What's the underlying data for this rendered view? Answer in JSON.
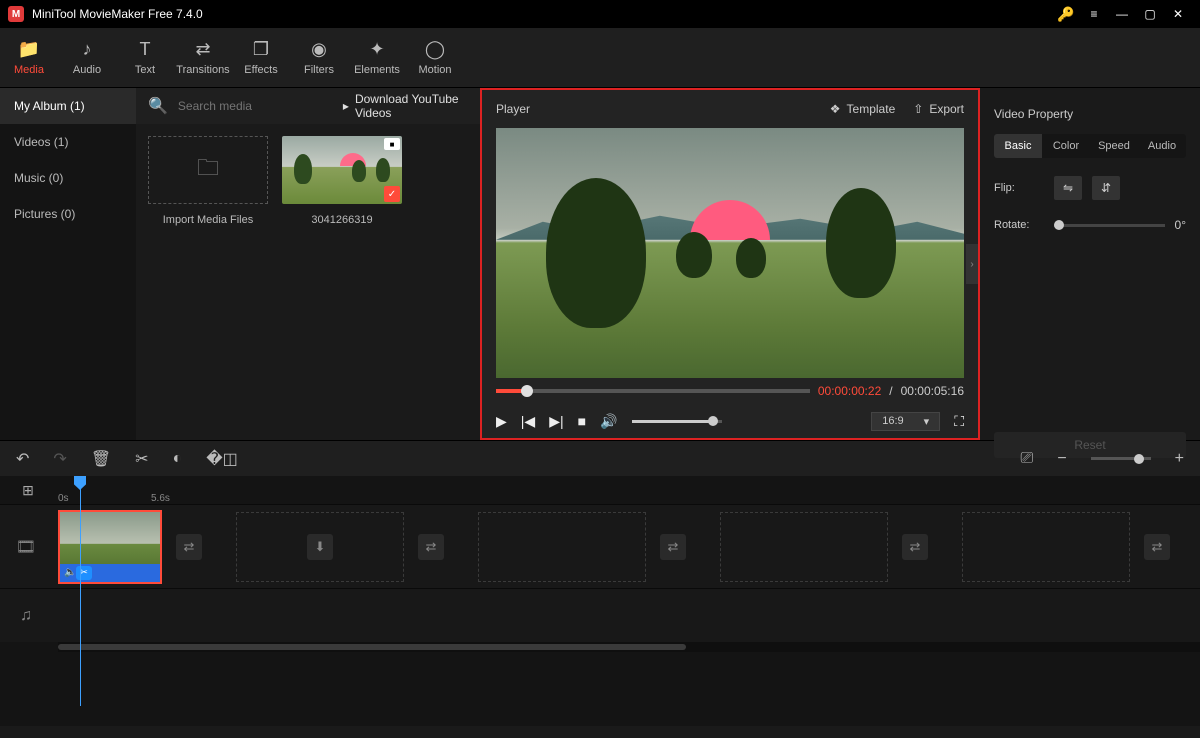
{
  "app": {
    "title": "MiniTool MovieMaker Free 7.4.0"
  },
  "toolTabs": [
    {
      "label": "Media",
      "icon": "📁"
    },
    {
      "label": "Audio",
      "icon": "♪"
    },
    {
      "label": "Text",
      "icon": "T"
    },
    {
      "label": "Transitions",
      "icon": "⇄"
    },
    {
      "label": "Effects",
      "icon": "❐"
    },
    {
      "label": "Filters",
      "icon": "◉"
    },
    {
      "label": "Elements",
      "icon": "✦"
    },
    {
      "label": "Motion",
      "icon": "◯"
    }
  ],
  "sidebar": {
    "items": [
      {
        "label": "My Album (1)"
      },
      {
        "label": "Videos (1)"
      },
      {
        "label": "Music (0)"
      },
      {
        "label": "Pictures (0)"
      }
    ]
  },
  "search": {
    "placeholder": "Search media"
  },
  "downloadLink": "Download YouTube Videos",
  "mediaCards": {
    "import": "Import Media Files",
    "clip1": "3041266319"
  },
  "player": {
    "title": "Player",
    "template": "Template",
    "export": "Export",
    "timeCurrent": "00:00:00:22",
    "timeTotal": "00:00:05:16",
    "aspect": "16:9"
  },
  "props": {
    "title": "Video Property",
    "tabs": [
      "Basic",
      "Color",
      "Speed",
      "Audio"
    ],
    "flipLabel": "Flip:",
    "rotateLabel": "Rotate:",
    "rotateValue": "0°",
    "reset": "Reset"
  },
  "ruler": {
    "t0": "0s",
    "t1": "5.6s"
  }
}
